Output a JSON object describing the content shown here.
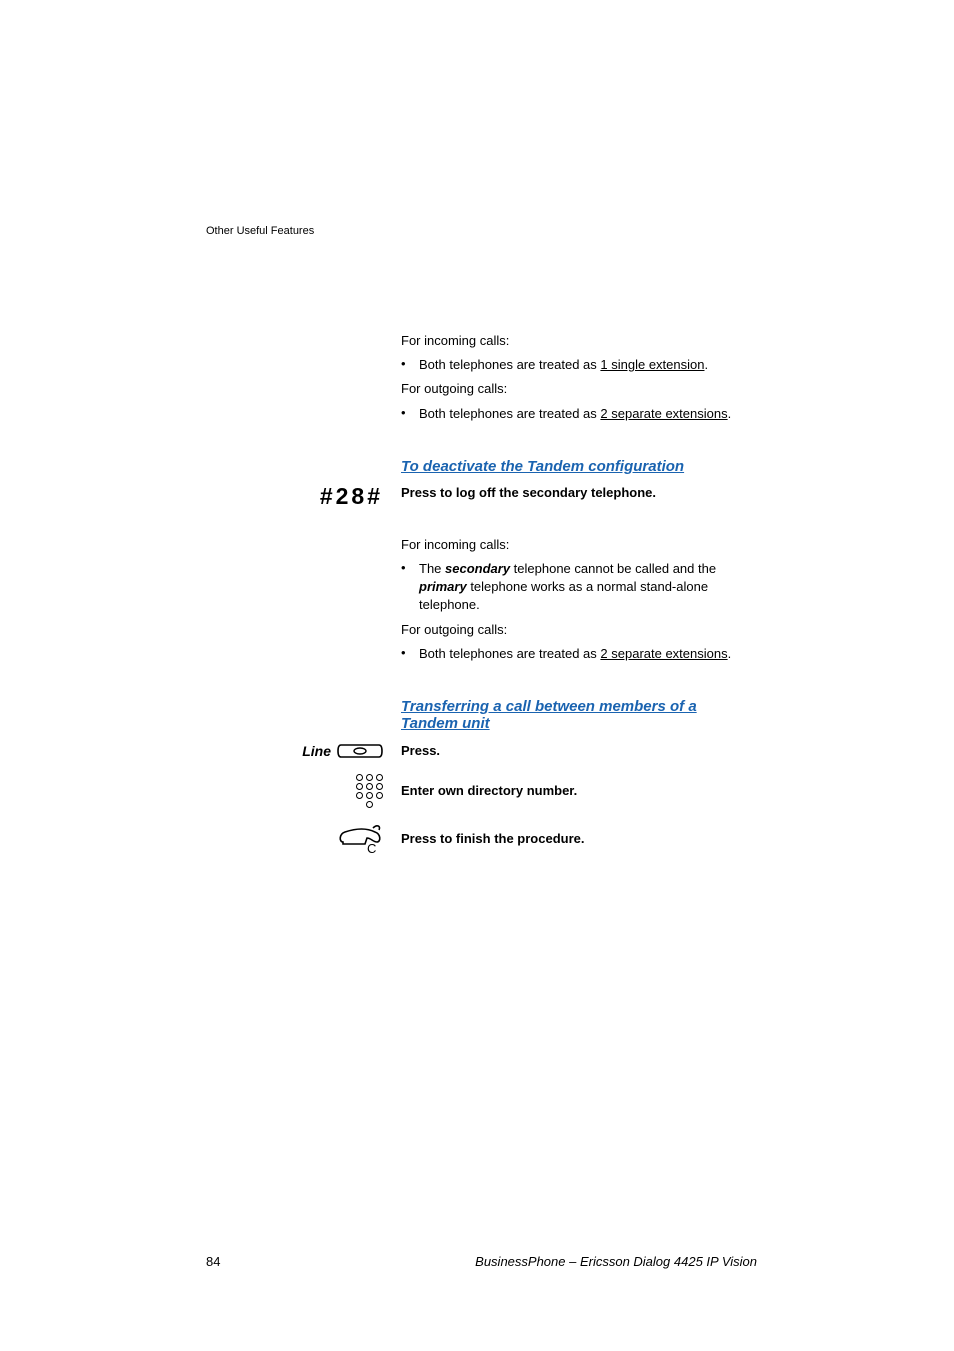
{
  "header": {
    "section_title": "Other Useful Features"
  },
  "body": {
    "incoming_label_1": "For incoming calls:",
    "bullet_1_pre": "Both telephones are treated as ",
    "bullet_1_ul": "1 single extension",
    "bullet_1_post": ".",
    "outgoing_label_1": "For outgoing calls:",
    "bullet_2_pre": "Both telephones are treated as ",
    "bullet_2_ul": "2 separate extensions",
    "bullet_2_post": ".",
    "section_deactivate": "To deactivate the Tandem configuration",
    "key_code": "#28#",
    "press_logoff": "Press to log off the secondary telephone.",
    "incoming_label_2": "For incoming calls:",
    "bullet_3_pre": "The ",
    "bullet_3_em1": "secondary",
    "bullet_3_mid": " telephone cannot be called and the ",
    "bullet_3_em2": "primary",
    "bullet_3_post": " telephone works as a normal stand-alone telephone.",
    "outgoing_label_2": "For outgoing calls:",
    "bullet_4_pre": "Both telephones are treated as ",
    "bullet_4_ul": "2 separate extensions",
    "bullet_4_post": ".",
    "section_transfer": "Transferring a call between members of a Tandem unit",
    "line_label": "Line",
    "step_press": "Press.",
    "step_enter": "Enter own directory number.",
    "clear_key": "C",
    "step_finish": "Press to finish the procedure."
  },
  "footer": {
    "page_number": "84",
    "doc_title": "BusinessPhone – Ericsson Dialog 4425 IP Vision"
  }
}
